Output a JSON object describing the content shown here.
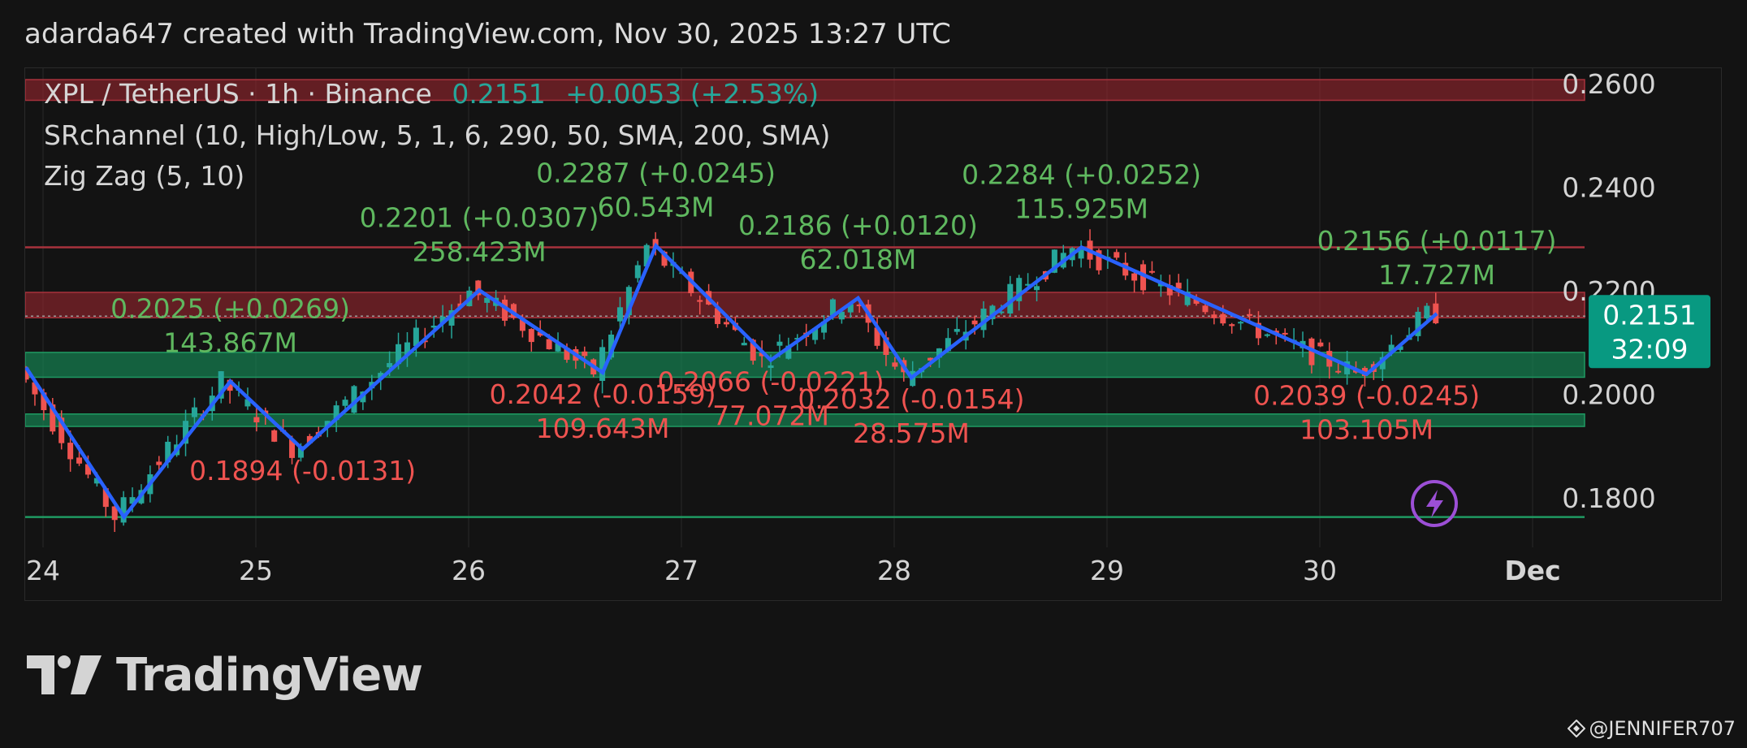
{
  "header": {
    "caption": "adarda647 created with TradingView.com, Nov 30, 2025 13:27 UTC"
  },
  "legend": {
    "symbol": "XPL / TetherUS · 1h · Binance",
    "price": "0.2151",
    "change": "+0.0053 (+2.53%)",
    "indicator1": "SRchannel (10, High/Low, 5, 1, 6, 290, 50, SMA, 200, SMA)",
    "indicator2": "Zig Zag (5, 10)"
  },
  "price_tag": {
    "price": "0.2151",
    "countdown": "32:09"
  },
  "logo": {
    "text": "TradingView"
  },
  "watermark": {
    "text": "@JENNIFER707"
  },
  "colors": {
    "background": "#131313",
    "up": "#26a69a",
    "down": "#ef5350",
    "zigzag": "#2962ff",
    "label_up": "#5fb85f",
    "label_down": "#ef5350",
    "resistance": "#8b2630",
    "support": "#1b7a4e"
  },
  "chart_data": {
    "type": "candlestick",
    "symbol": "XPL / TetherUS",
    "interval": "1h",
    "exchange": "Binance",
    "ylim": [
      0.172,
      0.263
    ],
    "y_ticks": [
      "0.2600",
      "0.2400",
      "0.2200",
      "0.2000",
      "0.1800"
    ],
    "x_ticks": [
      "24",
      "25",
      "26",
      "27",
      "28",
      "29",
      "30",
      "Dec"
    ],
    "x_range_days": [
      23.92,
      31.35
    ],
    "last_price": 0.2151,
    "zones": [
      {
        "kind": "resistance",
        "low": 0.2568,
        "high": 0.2608
      },
      {
        "kind": "resistance",
        "low": 0.2148,
        "high": 0.2197
      },
      {
        "kind": "support",
        "low": 0.2033,
        "high": 0.2081
      },
      {
        "kind": "support",
        "low": 0.1938,
        "high": 0.1962
      }
    ],
    "lines": [
      {
        "kind": "resistance",
        "value": 0.2284
      },
      {
        "kind": "support",
        "value": 0.1763
      }
    ],
    "zigzag": [
      [
        23.92,
        0.2052
      ],
      [
        24.38,
        0.1763
      ],
      [
        24.88,
        0.2025
      ],
      [
        25.22,
        0.1894
      ],
      [
        26.05,
        0.2201
      ],
      [
        26.63,
        0.2042
      ],
      [
        26.88,
        0.2287
      ],
      [
        27.42,
        0.2066
      ],
      [
        27.83,
        0.2186
      ],
      [
        28.08,
        0.2032
      ],
      [
        28.88,
        0.2284
      ],
      [
        30.22,
        0.2039
      ],
      [
        30.55,
        0.2156
      ]
    ],
    "pivot_labels": [
      {
        "day": 24.88,
        "text": "0.2025 (+0.0269)",
        "volume": "143.867M",
        "dir": "up"
      },
      {
        "day": 26.05,
        "text": "0.2201 (+0.0307)",
        "volume": "258.423M",
        "dir": "up"
      },
      {
        "day": 26.88,
        "text": "0.2287 (+0.0245)",
        "volume": "60.543M",
        "dir": "up"
      },
      {
        "day": 27.83,
        "text": "0.2186 (+0.0120)",
        "volume": "62.018M",
        "dir": "up"
      },
      {
        "day": 28.88,
        "text": "0.2284 (+0.0252)",
        "volume": "115.925M",
        "dir": "up"
      },
      {
        "day": 30.55,
        "text": "0.2156 (+0.0117)",
        "volume": "17.727M",
        "dir": "up"
      },
      {
        "day": 25.22,
        "text": "0.1894 (-0.0131)",
        "volume": "",
        "dir": "down"
      },
      {
        "day": 26.63,
        "text": "0.2042 (-0.0159)",
        "volume": "109.643M",
        "dir": "down"
      },
      {
        "day": 27.42,
        "text": "0.2066 (-0.0221)",
        "volume": "77.072M",
        "dir": "down"
      },
      {
        "day": 28.08,
        "text": "0.2032 (-0.0154)",
        "volume": "28.575M",
        "dir": "down"
      },
      {
        "day": 30.22,
        "text": "0.2039 (-0.0245)",
        "volume": "103.105M",
        "dir": "down"
      }
    ]
  }
}
